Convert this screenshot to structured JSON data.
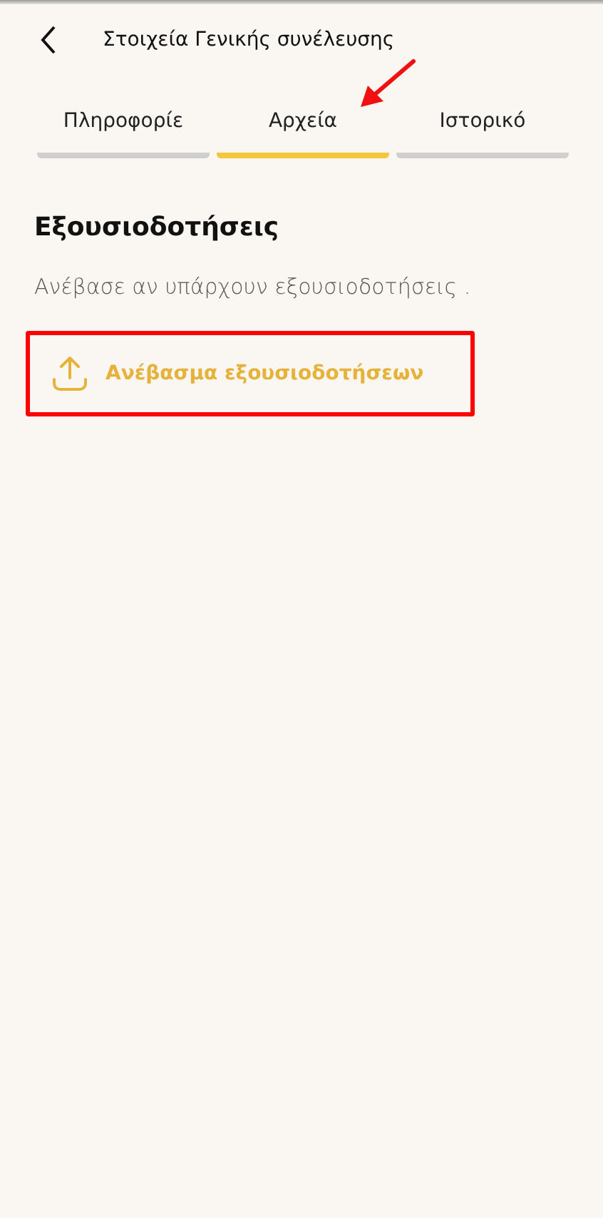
{
  "header": {
    "title": "Στοιχεία Γενικής συνέλευσης"
  },
  "tabs": [
    {
      "label": "Πληροφορίε",
      "selected": false
    },
    {
      "label": "Αρχεία",
      "selected": true
    },
    {
      "label": "Ιστορικό",
      "selected": false
    }
  ],
  "section": {
    "title": "Εξουσιοδοτήσεις",
    "description": "Ανέβασε αν υπάρχουν εξουσιοδοτήσεις .",
    "upload_button": "Ανέβασμα εξουσιοδοτήσεων"
  }
}
